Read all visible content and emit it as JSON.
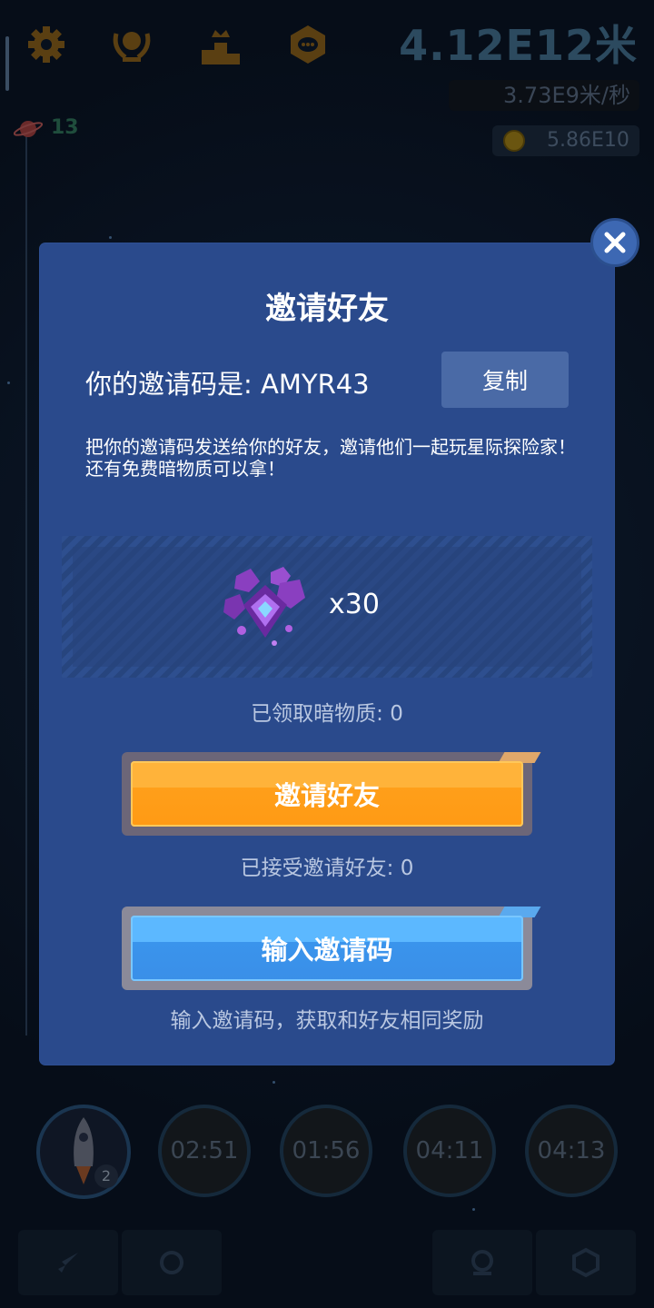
{
  "hud": {
    "distance": "4.12E12米",
    "speed": "3.73E9米/秒",
    "coins": "5.86E10",
    "level": "13",
    "icons": [
      "gear-icon",
      "laurel-medal-icon",
      "podium-icon",
      "chat-badge-icon"
    ]
  },
  "timers": [
    "02:51",
    "01:56",
    "04:11",
    "04:13"
  ],
  "rocket_badge": "2",
  "dialog": {
    "title": "邀请好友",
    "code_label": "你的邀请码是: AMYR43",
    "copy_label": "复制",
    "description": "把你的邀请码发送给你的好友，邀请他们一起玩星际探险家！还有免费暗物质可以拿！",
    "reward_count": "x30",
    "claimed_text": "已领取暗物质: 0",
    "invite_button": "邀请好友",
    "accepted_text": "已接受邀请好友: 0",
    "enter_code_button": "输入邀请码",
    "enter_code_hint": "输入邀请码，获取和好友相同奖励"
  },
  "colors": {
    "dialog_bg": "#2a4a8c",
    "invite_button": "#ff9f1a",
    "enter_button": "#3a94ec",
    "close_button": "#3d68b3"
  }
}
